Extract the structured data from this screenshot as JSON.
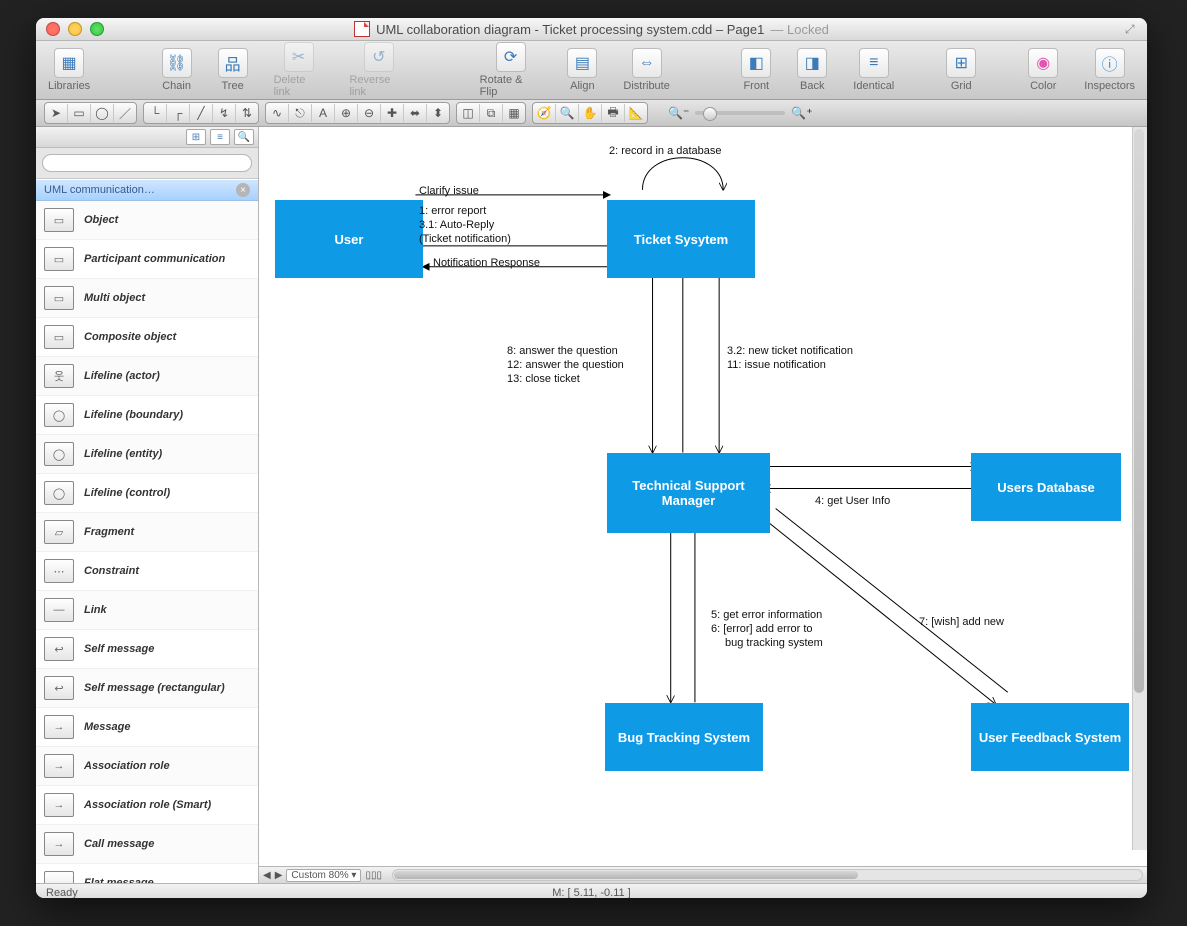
{
  "title": {
    "filename": "UML collaboration diagram - Ticket processing system.cdd",
    "page": "Page1",
    "state": "Locked"
  },
  "toolbar": [
    {
      "k": "libraries",
      "label": "Libraries",
      "glyph": "▦"
    },
    {
      "k": "chain",
      "label": "Chain",
      "glyph": "⛓"
    },
    {
      "k": "tree",
      "label": "Tree",
      "glyph": "品"
    },
    {
      "k": "deletelink",
      "label": "Delete link",
      "glyph": "✂",
      "dis": true
    },
    {
      "k": "reverselink",
      "label": "Reverse link",
      "glyph": "↺",
      "dis": true
    },
    {
      "k": "rotateflip",
      "label": "Rotate & Flip",
      "glyph": "⟳"
    },
    {
      "k": "align",
      "label": "Align",
      "glyph": "▤"
    },
    {
      "k": "distribute",
      "label": "Distribute",
      "glyph": "⇔"
    },
    {
      "k": "front",
      "label": "Front",
      "glyph": "◧"
    },
    {
      "k": "back",
      "label": "Back",
      "glyph": "◨"
    },
    {
      "k": "identical",
      "label": "Identical",
      "glyph": "≡"
    },
    {
      "k": "grid",
      "label": "Grid",
      "glyph": "⊞"
    },
    {
      "k": "color",
      "label": "Color",
      "glyph": "◉"
    },
    {
      "k": "inspectors",
      "label": "Inspectors",
      "glyph": "ⓘ"
    }
  ],
  "sidebar": {
    "header": "UML communication…",
    "items": [
      {
        "label": "Object",
        "glyph": "▭"
      },
      {
        "label": "Participant communication",
        "glyph": "▭"
      },
      {
        "label": "Multi object",
        "glyph": "▭"
      },
      {
        "label": "Composite object",
        "glyph": "▭"
      },
      {
        "label": "Lifeline (actor)",
        "glyph": "웃"
      },
      {
        "label": "Lifeline (boundary)",
        "glyph": "◯"
      },
      {
        "label": "Lifeline (entity)",
        "glyph": "◯"
      },
      {
        "label": "Lifeline (control)",
        "glyph": "◯"
      },
      {
        "label": "Fragment",
        "glyph": "▱"
      },
      {
        "label": "Constraint",
        "glyph": "⋯"
      },
      {
        "label": "Link",
        "glyph": "—"
      },
      {
        "label": "Self message",
        "glyph": "↩"
      },
      {
        "label": "Self message (rectangular)",
        "glyph": "↩"
      },
      {
        "label": "Message",
        "glyph": "→"
      },
      {
        "label": "Association role",
        "glyph": "→"
      },
      {
        "label": "Association role (Smart)",
        "glyph": "→"
      },
      {
        "label": "Call message",
        "glyph": "→"
      },
      {
        "label": "Flat message",
        "glyph": "→"
      }
    ]
  },
  "diagram": {
    "boxes": {
      "user": "User",
      "ticket": "Ticket Sysytem",
      "tsm": "Technical Support Manager",
      "udb": "Users Database",
      "bts": "Bug Tracking System",
      "ufs": "User Feedback System"
    },
    "labels": {
      "rec": "2: record in a database",
      "clar": "Clarify issue",
      "l1": "1: error report",
      "l2": "3.1: Auto-Reply",
      "l3": "(Ticket notification)",
      "notif": "Notification Response",
      "a8": "8: answer the question",
      "a12": "12: answer the question",
      "a13": "13: close ticket",
      "n32": "3.2: new ticket notification",
      "n11": "11: issue notification",
      "g4": "4: get User Info",
      "g5": "5: get error information",
      "g6a": "6: [error] add error to",
      "g6b": "bug tracking system",
      "w7": "7: [wish] add new"
    }
  },
  "footer": {
    "zoom": "Custom 80%",
    "status": "Ready",
    "mouse": "M: [ 5.11, -0.11 ]"
  }
}
